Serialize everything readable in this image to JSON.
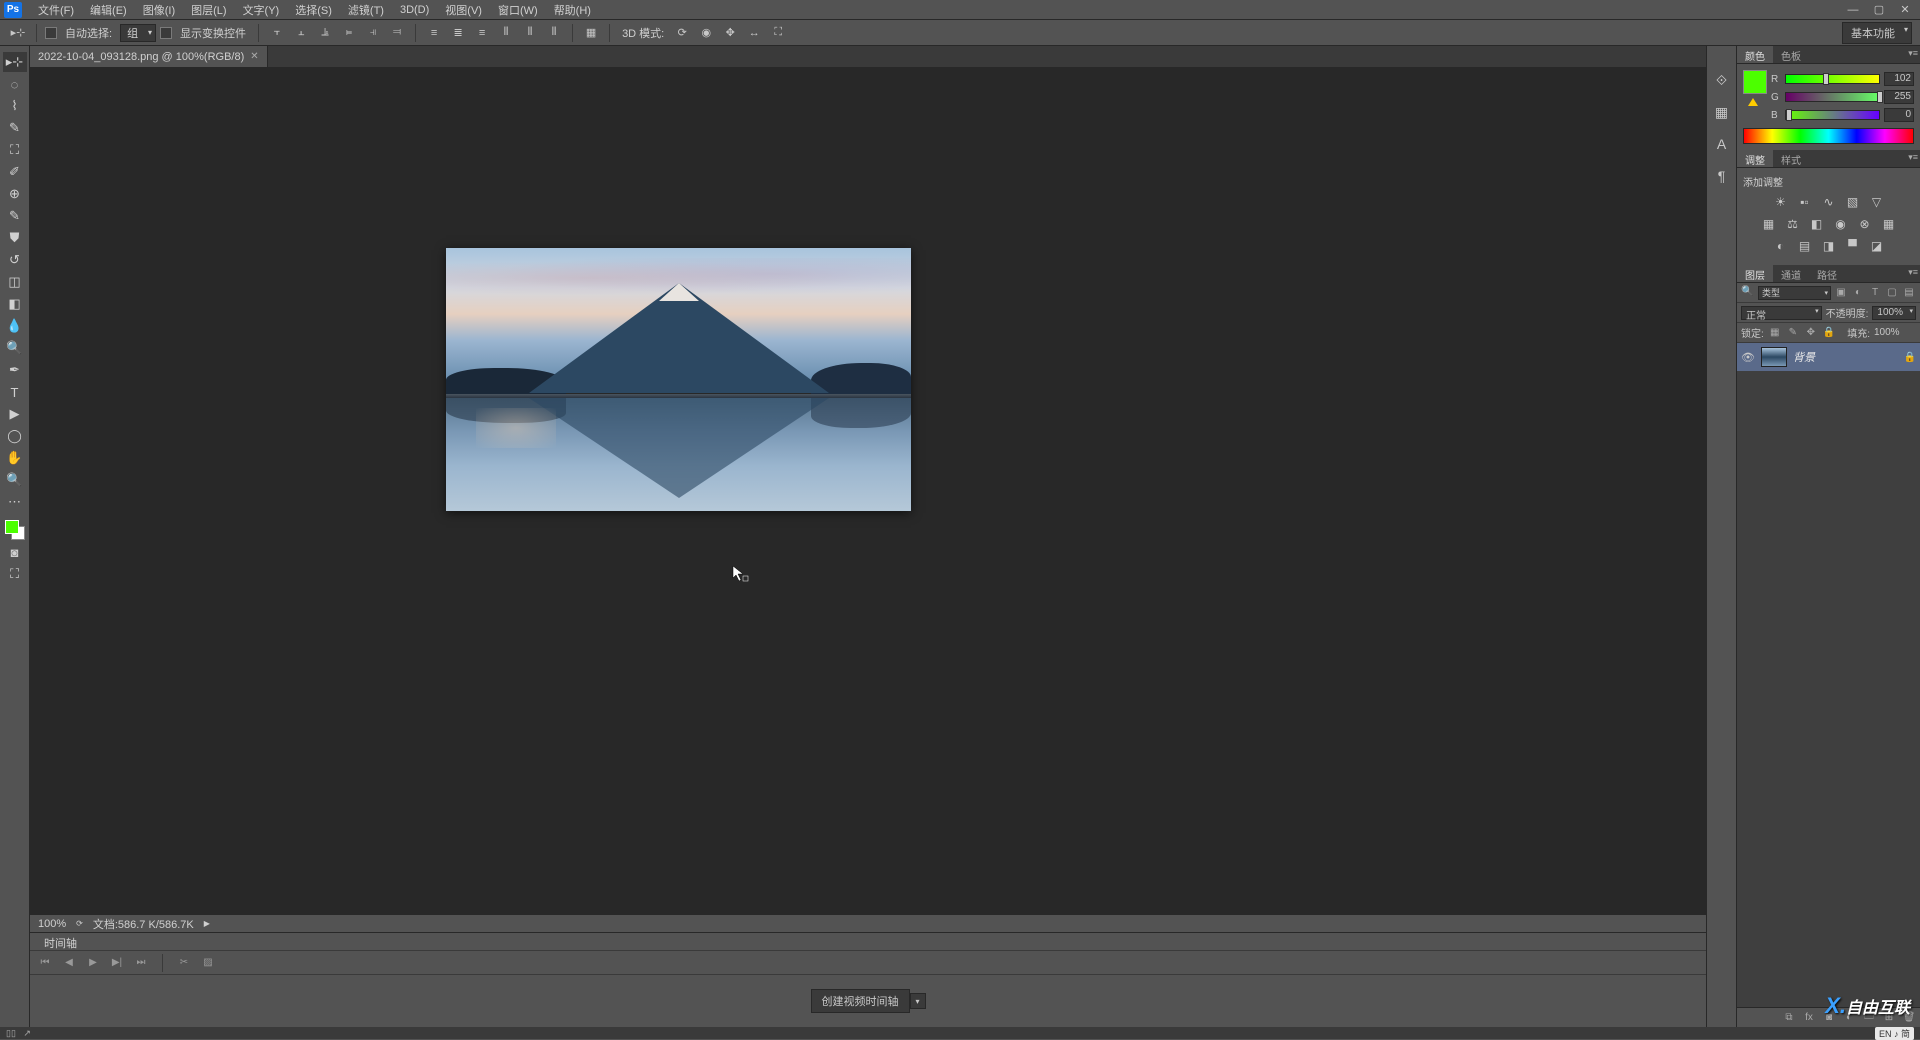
{
  "app": {
    "logo": "Ps"
  },
  "menu": {
    "file": "文件(F)",
    "edit": "编辑(E)",
    "image": "图像(I)",
    "layer": "图层(L)",
    "type": "文字(Y)",
    "select": "选择(S)",
    "filter": "滤镜(T)",
    "three_d": "3D(D)",
    "view": "视图(V)",
    "window": "窗口(W)",
    "help": "帮助(H)"
  },
  "options": {
    "auto_select": "自动选择:",
    "auto_select_value": "组",
    "show_transform": "显示变换控件",
    "three_d_mode": "3D 模式:",
    "workspace": "基本功能"
  },
  "document": {
    "tab_title": "2022-10-04_093128.png @ 100%(RGB/8)",
    "zoom": "100%",
    "doc_info": "文档:586.7 K/586.7K"
  },
  "panel_tabs": {
    "color": "颜色",
    "swatches": "色板",
    "adjustments": "调整",
    "styles": "样式",
    "layers": "图层",
    "channels": "通道",
    "paths": "路径",
    "timeline": "时间轴"
  },
  "color": {
    "r_label": "R",
    "r_value": "102",
    "g_label": "G",
    "g_value": "255",
    "b_label": "B",
    "b_value": "0",
    "foreground": "#4cff00"
  },
  "adjustments": {
    "add_label": "添加调整"
  },
  "layers": {
    "filter_type": "类型",
    "blend_mode": "正常",
    "opacity_label": "不透明度:",
    "opacity_value": "100%",
    "lock_label": "锁定:",
    "fill_label": "填充:",
    "fill_value": "100%",
    "layer_name": "背景"
  },
  "timeline": {
    "create_video": "创建视频时间轴"
  },
  "os": {
    "ime": "EN ♪ 简"
  },
  "watermark": {
    "text": "自由互联"
  }
}
